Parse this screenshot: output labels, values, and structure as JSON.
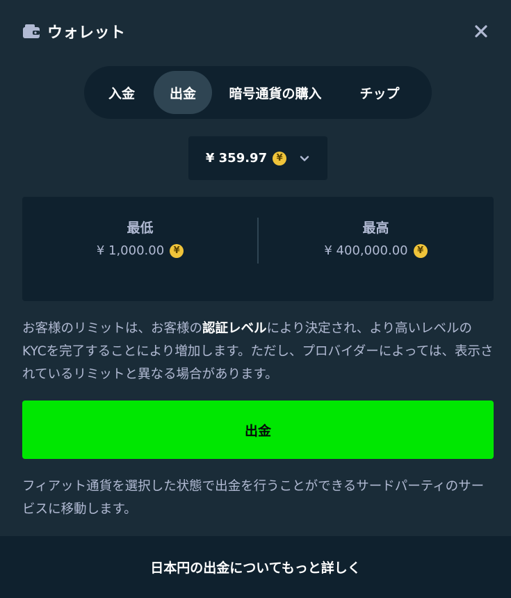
{
  "header": {
    "title": "ウォレット",
    "icon": "wallet-icon",
    "close_icon": "close-icon"
  },
  "tabs": [
    {
      "label": "入金",
      "active": false
    },
    {
      "label": "出金",
      "active": true
    },
    {
      "label": "暗号通貨の購入",
      "active": false
    },
    {
      "label": "チップ",
      "active": false
    }
  ],
  "currency": {
    "amount": "¥ 359.97",
    "coin_symbol": "¥",
    "coin_color": "#f0c43a"
  },
  "limits": {
    "min_label": "最低",
    "min_value": "¥ 1,000.00",
    "max_label": "最高",
    "max_value": "¥ 400,000.00"
  },
  "info": {
    "part1": "お客様のリミットは、お客様の",
    "bold": "認証レベル",
    "part2": "により決定され、より高いレベルのKYCを完了することにより増加します。ただし、プロバイダーによっては、表示されているリミットと異なる場合があります。"
  },
  "withdraw_button": {
    "label": "出金",
    "color": "#00e701"
  },
  "note": "フィアット通貨を選択した状態で出金を行うことができるサードパーティのサービスに移動します。",
  "footer": {
    "link": "日本円の出金についてもっと詳しく"
  },
  "colors": {
    "background": "#1a2c38",
    "panel": "#0f212e",
    "active_tab": "#2f4553"
  }
}
